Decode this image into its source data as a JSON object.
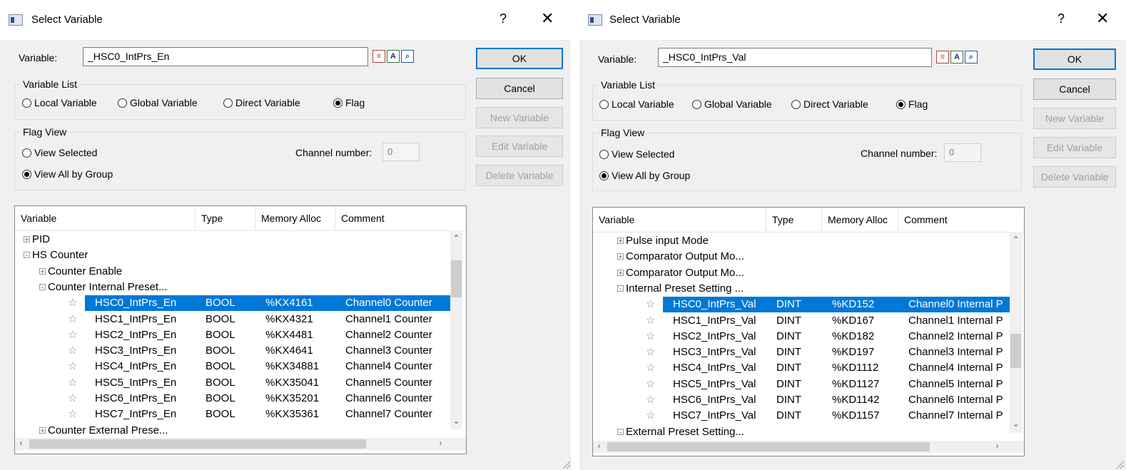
{
  "dialogs": [
    {
      "title": "Select Variable",
      "help": "?",
      "close": "✕",
      "variable_label": "Variable:",
      "variable_value": "_HSC0_IntPrs_En",
      "buttons": {
        "ok": "OK",
        "cancel": "Cancel",
        "new": "New Variable",
        "edit": "Edit Variable",
        "delete": "Delete Variable"
      },
      "variable_list": {
        "title": "Variable List",
        "options": [
          "Local Variable",
          "Global Variable",
          "Direct Variable",
          "Flag"
        ],
        "selected": "Flag"
      },
      "flag_view": {
        "title": "Flag View",
        "options": [
          "View Selected",
          "View All by Group"
        ],
        "selected": "View All by Group",
        "channel_label": "Channel number:",
        "channel_value": "0"
      },
      "columns": [
        "Variable",
        "Type",
        "Memory Alloc",
        "Comment"
      ],
      "rows": [
        {
          "kind": "group",
          "level": 0,
          "expander": "+",
          "name": "PID"
        },
        {
          "kind": "group",
          "level": 0,
          "expander": "-",
          "name": "HS Counter"
        },
        {
          "kind": "group",
          "level": 1,
          "expander": "+",
          "name": "Counter Enable"
        },
        {
          "kind": "group",
          "level": 1,
          "expander": "-",
          "name": "Counter Internal Preset..."
        },
        {
          "kind": "leaf",
          "name": "HSC0_IntPrs_En",
          "type": "BOOL",
          "mem": "%KX4161",
          "comment": "Channel0 Counter",
          "selected": true
        },
        {
          "kind": "leaf",
          "name": "HSC1_IntPrs_En",
          "type": "BOOL",
          "mem": "%KX4321",
          "comment": "Channel1 Counter"
        },
        {
          "kind": "leaf",
          "name": "HSC2_IntPrs_En",
          "type": "BOOL",
          "mem": "%KX4481",
          "comment": "Channel2 Counter"
        },
        {
          "kind": "leaf",
          "name": "HSC3_IntPrs_En",
          "type": "BOOL",
          "mem": "%KX4641",
          "comment": "Channel3 Counter"
        },
        {
          "kind": "leaf",
          "name": "HSC4_IntPrs_En",
          "type": "BOOL",
          "mem": "%KX34881",
          "comment": "Channel4 Counter"
        },
        {
          "kind": "leaf",
          "name": "HSC5_IntPrs_En",
          "type": "BOOL",
          "mem": "%KX35041",
          "comment": "Channel5 Counter"
        },
        {
          "kind": "leaf",
          "name": "HSC6_IntPrs_En",
          "type": "BOOL",
          "mem": "%KX35201",
          "comment": "Channel6 Counter"
        },
        {
          "kind": "leaf",
          "name": "HSC7_IntPrs_En",
          "type": "BOOL",
          "mem": "%KX35361",
          "comment": "Channel7 Counter"
        },
        {
          "kind": "group",
          "level": 1,
          "expander": "+",
          "name": "Counter External Prese..."
        }
      ]
    },
    {
      "title": "Select Variable",
      "help": "?",
      "close": "✕",
      "variable_label": "Variable:",
      "variable_value": "_HSC0_IntPrs_Val",
      "buttons": {
        "ok": "OK",
        "cancel": "Cancel",
        "new": "New Variable",
        "edit": "Edit Variable",
        "delete": "Delete Variable"
      },
      "variable_list": {
        "title": "Variable List",
        "options": [
          "Local Variable",
          "Global Variable",
          "Direct Variable",
          "Flag"
        ],
        "selected": "Flag"
      },
      "flag_view": {
        "title": "Flag View",
        "options": [
          "View Selected",
          "View All by Group"
        ],
        "selected": "View All by Group",
        "channel_label": "Channel number:",
        "channel_value": "0"
      },
      "columns": [
        "Variable",
        "Type",
        "Memory Alloc",
        "Comment"
      ],
      "rows": [
        {
          "kind": "group",
          "level": 1,
          "expander": "+",
          "name": "Pulse input Mode"
        },
        {
          "kind": "group",
          "level": 1,
          "expander": "+",
          "name": "Comparator Output Mo..."
        },
        {
          "kind": "group",
          "level": 1,
          "expander": "+",
          "name": "Comparator Output Mo..."
        },
        {
          "kind": "group",
          "level": 1,
          "expander": "-",
          "name": "Internal Preset Setting ..."
        },
        {
          "kind": "leaf",
          "name": "HSC0_IntPrs_Val",
          "type": "DINT",
          "mem": "%KD152",
          "comment": "Channel0 Internal P",
          "selected": true
        },
        {
          "kind": "leaf",
          "name": "HSC1_IntPrs_Val",
          "type": "DINT",
          "mem": "%KD167",
          "comment": "Channel1 Internal P"
        },
        {
          "kind": "leaf",
          "name": "HSC2_IntPrs_Val",
          "type": "DINT",
          "mem": "%KD182",
          "comment": "Channel2 Internal P"
        },
        {
          "kind": "leaf",
          "name": "HSC3_IntPrs_Val",
          "type": "DINT",
          "mem": "%KD197",
          "comment": "Channel3 Internal P"
        },
        {
          "kind": "leaf",
          "name": "HSC4_IntPrs_Val",
          "type": "DINT",
          "mem": "%KD1112",
          "comment": "Channel4 Internal P"
        },
        {
          "kind": "leaf",
          "name": "HSC5_IntPrs_Val",
          "type": "DINT",
          "mem": "%KD1127",
          "comment": "Channel5 Internal P"
        },
        {
          "kind": "leaf",
          "name": "HSC6_IntPrs_Val",
          "type": "DINT",
          "mem": "%KD1142",
          "comment": "Channel6 Internal P"
        },
        {
          "kind": "leaf",
          "name": "HSC7_IntPrs_Val",
          "type": "DINT",
          "mem": "%KD1157",
          "comment": "Channel7 Internal P"
        },
        {
          "kind": "group",
          "level": 1,
          "expander": "-",
          "name": "External Preset Setting..."
        }
      ]
    }
  ],
  "colors": {
    "selection": "#0078d7",
    "dialog_bg": "#f0f0f0",
    "default_button_border": "#0078d7"
  }
}
